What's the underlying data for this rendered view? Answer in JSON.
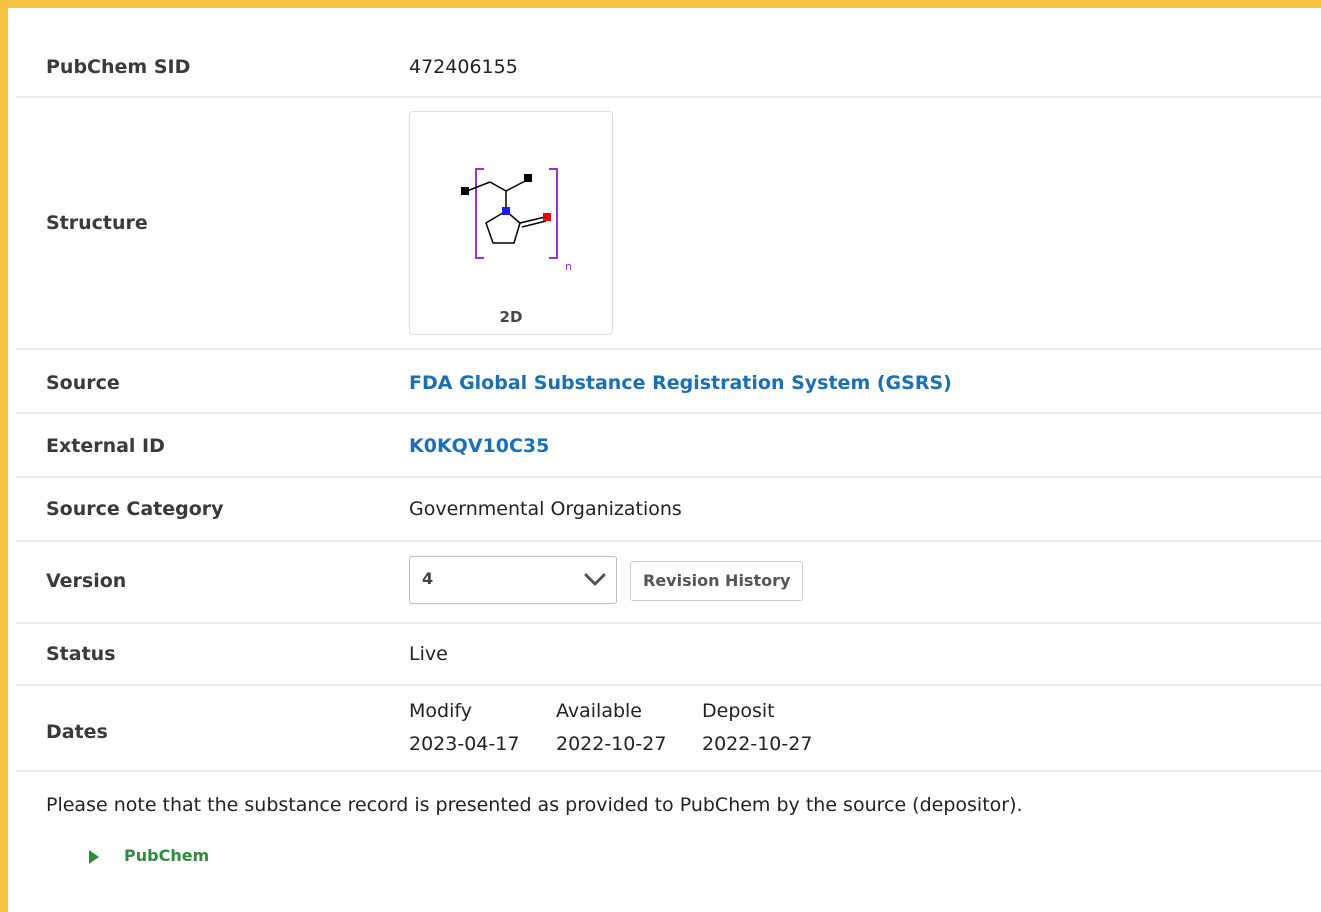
{
  "record": {
    "sid_label": "PubChem SID",
    "sid_value": "472406155",
    "structure_label": "Structure",
    "structure_caption": "2D",
    "structure_bracket_subscript": "n",
    "source_label": "Source",
    "source_value": "FDA Global Substance Registration System (GSRS)",
    "external_id_label": "External ID",
    "external_id_value": "K0KQV10C35",
    "source_category_label": "Source Category",
    "source_category_value": "Governmental Organizations",
    "version_label": "Version",
    "version_selected": "4",
    "revision_history_label": "Revision History",
    "status_label": "Status",
    "status_value": "Live",
    "dates_label": "Dates",
    "dates": [
      {
        "label": "Modify",
        "value": "2023-04-17"
      },
      {
        "label": "Available",
        "value": "2022-10-27"
      },
      {
        "label": "Deposit",
        "value": "2022-10-27"
      }
    ]
  },
  "note": "Please note that the substance record is presented as provided to PubChem by the source (depositor).",
  "pubchem_toggle_label": "PubChem",
  "colors": {
    "frame_accent": "#f5c242",
    "link": "#1a6fb5",
    "toggle_green": "#2e8b3e"
  },
  "icons": {
    "version_dropdown": "chevron-down-icon",
    "pubchem_toggle": "caret-right-icon"
  }
}
